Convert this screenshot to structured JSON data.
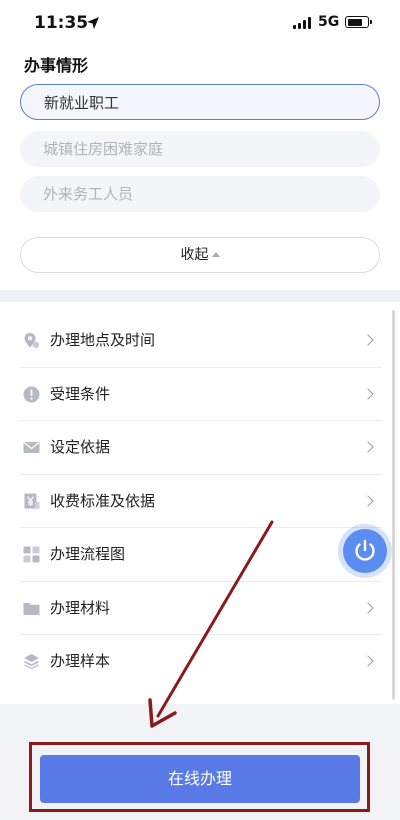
{
  "status_bar": {
    "time": "11:35",
    "network": "5G"
  },
  "section": {
    "title": "办事情形"
  },
  "options": [
    {
      "label": "新就业职工",
      "selected": true
    },
    {
      "label": "城镇住房困难家庭",
      "selected": false
    },
    {
      "label": "外来务工人员",
      "selected": false
    }
  ],
  "collapse": {
    "label": "收起"
  },
  "menu": [
    {
      "label": "办理地点及时间",
      "icon": "location-pin-icon"
    },
    {
      "label": "受理条件",
      "icon": "alert-circle-icon"
    },
    {
      "label": "设定依据",
      "icon": "envelope-icon"
    },
    {
      "label": "收费标准及依据",
      "icon": "yen-document-icon"
    },
    {
      "label": "办理流程图",
      "icon": "grid-flow-icon"
    },
    {
      "label": "办理材料",
      "icon": "folder-icon"
    },
    {
      "label": "办理样本",
      "icon": "layers-icon"
    }
  ],
  "action": {
    "online_label": "在线办理"
  },
  "colors": {
    "accent": "#5879e6",
    "annotation": "#8b1a1a",
    "float_button": "#5b8cf0"
  }
}
